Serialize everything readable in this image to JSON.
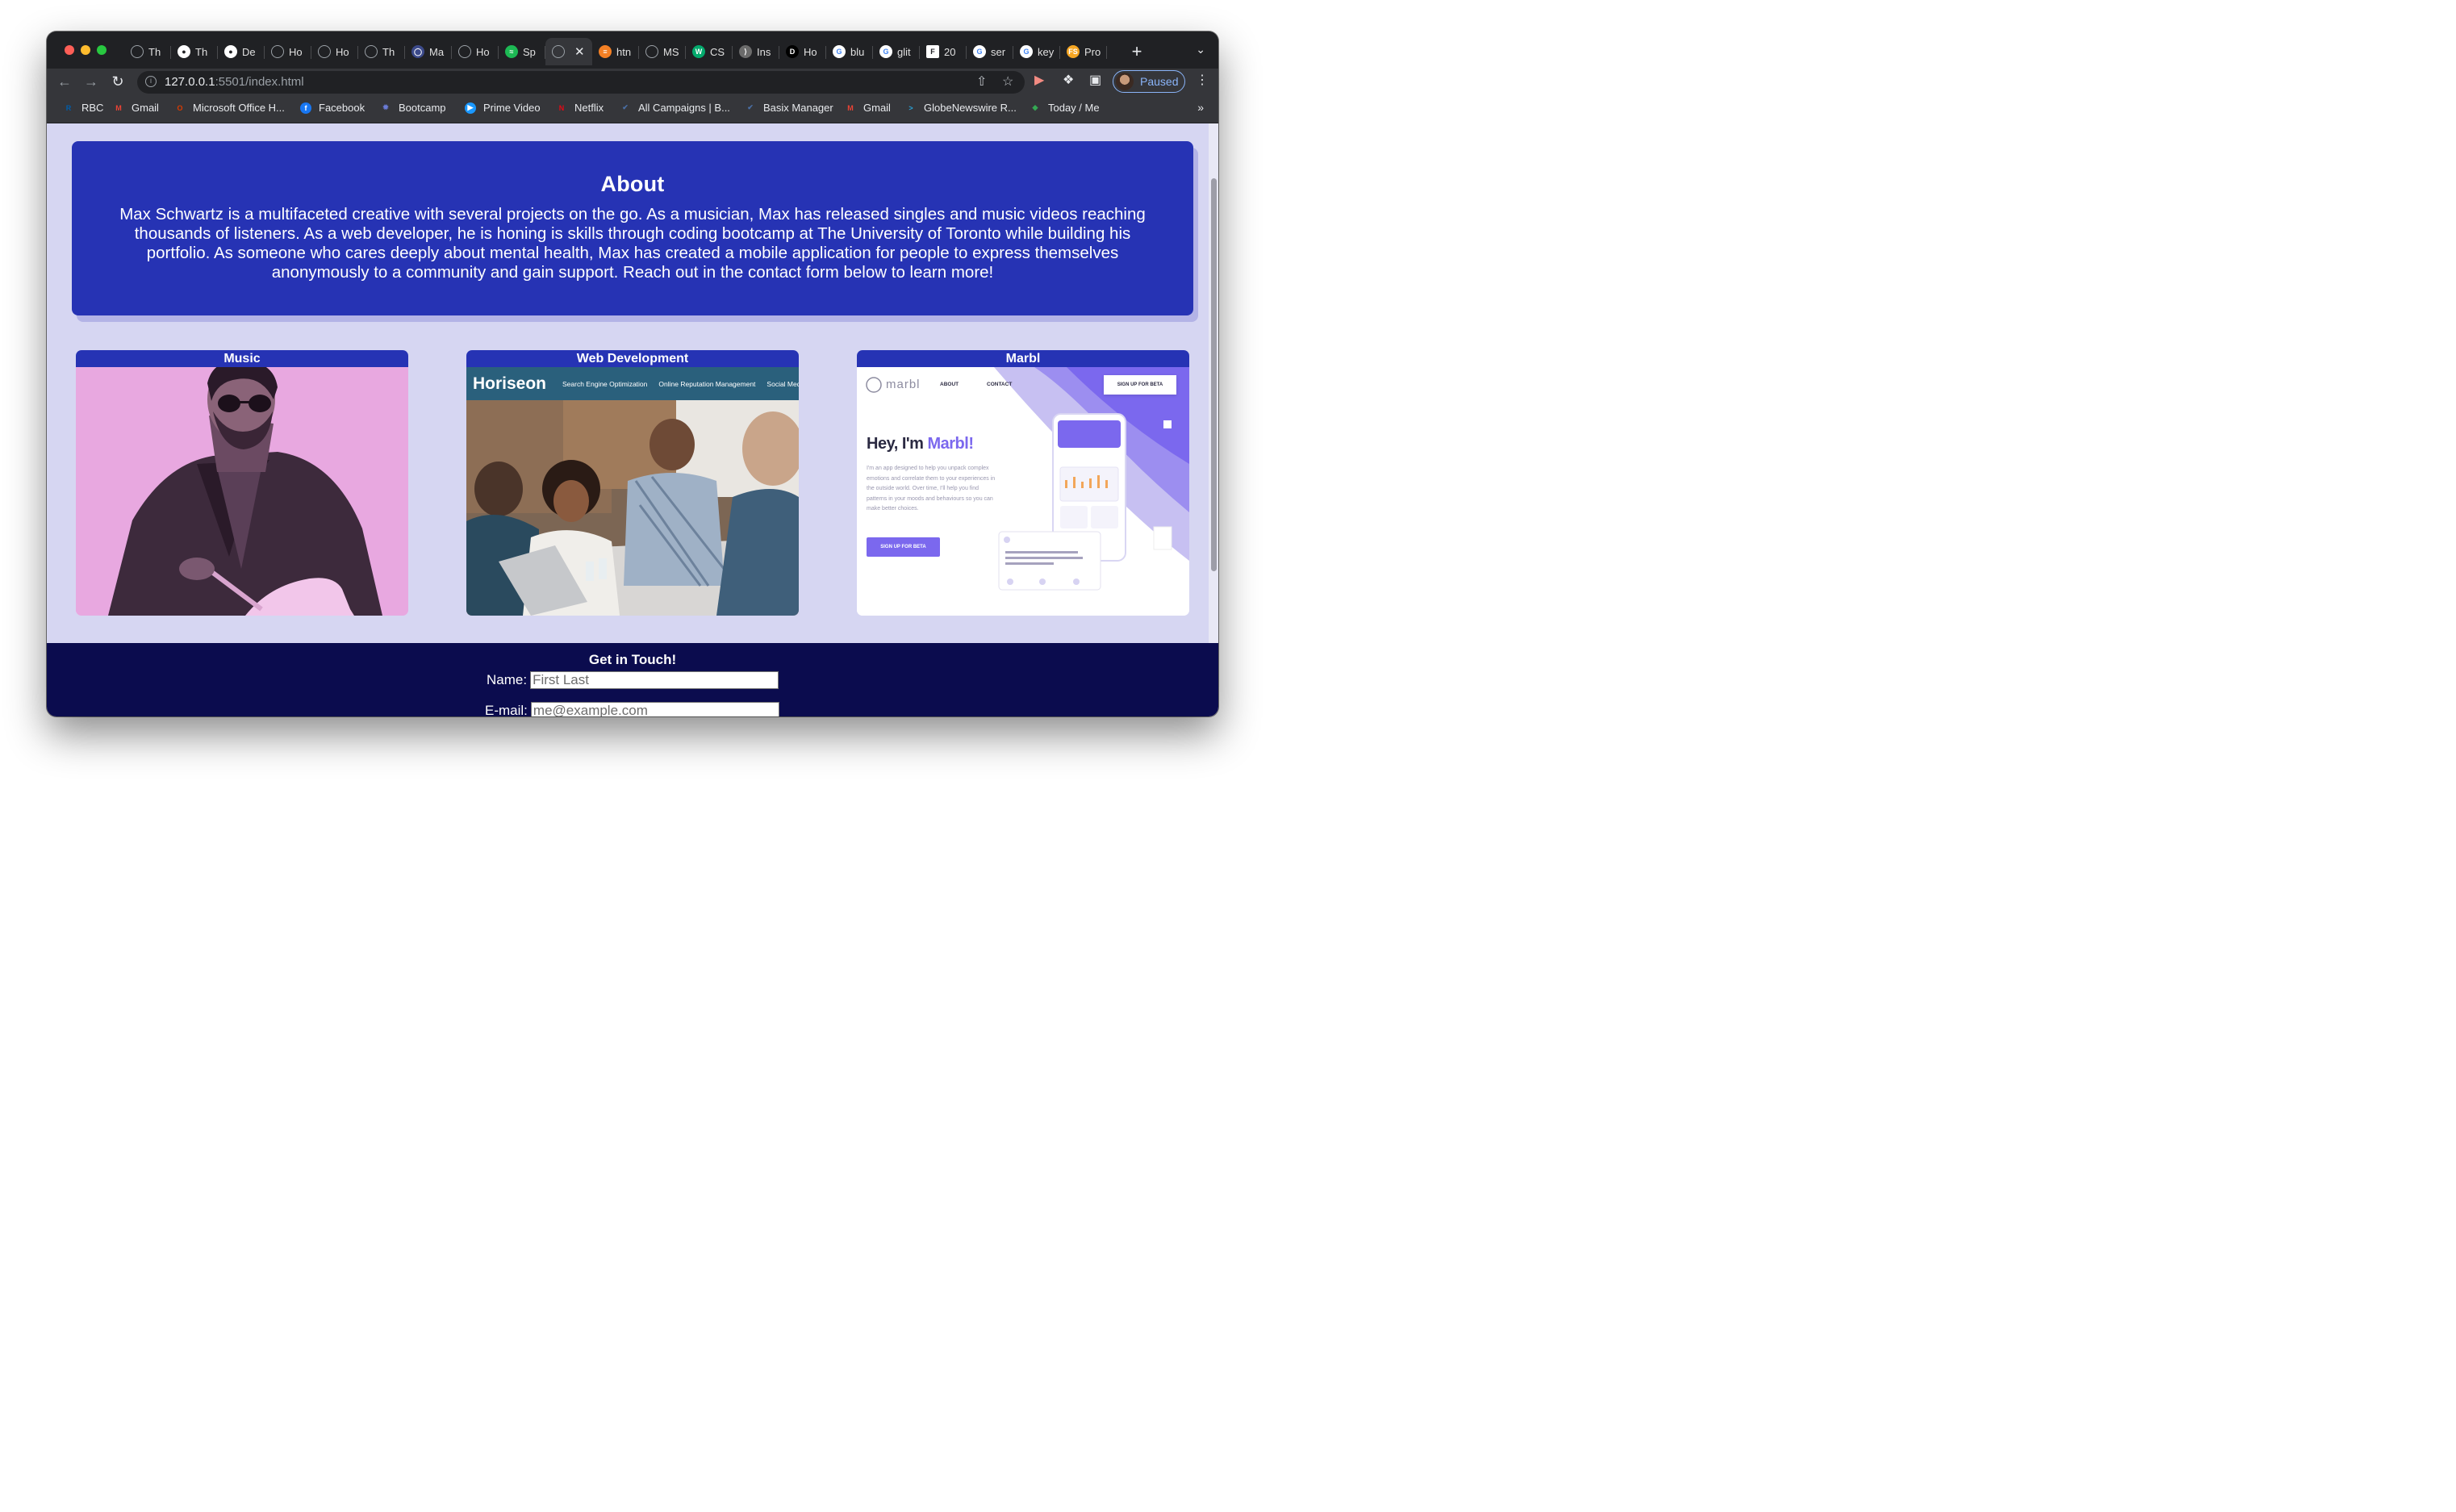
{
  "tabs": [
    {
      "label": "Th",
      "icon": "globe-icon",
      "color": "#9aa0a6"
    },
    {
      "label": "Th",
      "icon": "github-icon",
      "color": "#ffffff"
    },
    {
      "label": "De",
      "icon": "github-icon",
      "color": "#ffffff"
    },
    {
      "label": "Ho",
      "icon": "globe-icon",
      "color": "#9aa0a6"
    },
    {
      "label": "Ho",
      "icon": "globe-icon",
      "color": "#9aa0a6"
    },
    {
      "label": "Th",
      "icon": "globe-icon",
      "color": "#9aa0a6"
    },
    {
      "label": "Ma",
      "icon": "marbl-icon",
      "color": "#3c4a8a"
    },
    {
      "label": "Ho",
      "icon": "globe-icon",
      "color": "#9aa0a6"
    },
    {
      "label": "Sp",
      "icon": "spotify-icon",
      "color": "#1db954"
    },
    {
      "label": "",
      "icon": "globe-icon",
      "color": "#9aa0a6",
      "active": true
    },
    {
      "label": "htn",
      "icon": "stackoverflow-icon",
      "color": "#f48024"
    },
    {
      "label": "MS",
      "icon": "globe-icon",
      "color": "#9aa0a6"
    },
    {
      "label": "CS",
      "icon": "w3schools-icon",
      "color": "#04aa6d"
    },
    {
      "label": "Ins",
      "icon": "insomnia-icon",
      "color": "#6b6b6b"
    },
    {
      "label": "Ho",
      "icon": "dev-icon",
      "color": "#000000"
    },
    {
      "label": "blu",
      "icon": "google-icon",
      "color": "#4285f4"
    },
    {
      "label": "glit",
      "icon": "google-icon",
      "color": "#4285f4"
    },
    {
      "label": "20",
      "icon": "f-icon",
      "color": "#ffffff"
    },
    {
      "label": "ser",
      "icon": "google-icon",
      "color": "#4285f4"
    },
    {
      "label": "key",
      "icon": "google-icon",
      "color": "#4285f4"
    },
    {
      "label": "Pro",
      "icon": "fs-icon",
      "color": "#f5a623"
    }
  ],
  "toolbar": {
    "url_host": "127.0.0.1",
    "url_rest": ":5501/index.html",
    "profile_status": "Paused"
  },
  "bookmarks": [
    {
      "label": "RBC",
      "icon": "rbc-icon",
      "color": "#005daa"
    },
    {
      "label": "Gmail",
      "icon": "gmail-icon",
      "color": "#ea4335"
    },
    {
      "label": "Microsoft Office H...",
      "icon": "office-icon",
      "color": "#d83b01"
    },
    {
      "label": "Facebook",
      "icon": "facebook-icon",
      "color": "#1877f2"
    },
    {
      "label": "Bootcamp",
      "icon": "bootcamp-icon",
      "color": "#6a7bd6"
    },
    {
      "label": "Prime Video",
      "icon": "prime-video-icon",
      "color": "#1a98ff"
    },
    {
      "label": "Netflix",
      "icon": "netflix-icon",
      "color": "#e50914"
    },
    {
      "label": "All Campaigns | B...",
      "icon": "campaign-icon",
      "color": "#4a6fa5"
    },
    {
      "label": "Basix Manager",
      "icon": "basix-icon",
      "color": "#4a6fa5"
    },
    {
      "label": "Gmail",
      "icon": "gmail-icon",
      "color": "#ea4335"
    },
    {
      "label": "GlobeNewswire R...",
      "icon": "globenewswire-icon",
      "color": "#2aa3d8"
    },
    {
      "label": "Today / Me",
      "icon": "today-icon",
      "color": "#34a853"
    }
  ],
  "about": {
    "title": "About",
    "body": "Max Schwartz is a multifaceted creative with several projects on the go. As a musician, Max has released singles and music videos reaching thousands of listeners. As a web developer, he is honing is skills through coding bootcamp at The University of Toronto while building his portfolio. As someone who cares deeply about mental health, Max has created a mobile application for people to express themselves anonymously to a community and gain support. Reach out in the contact form below to learn more!"
  },
  "projects": [
    {
      "title": "Music"
    },
    {
      "title": "Web Development",
      "site_logo": "Horiseon",
      "site_nav": [
        "Search Engine Optimization",
        "Online Reputation Management",
        "Social Media"
      ]
    },
    {
      "title": "Marbl",
      "app_logo": "marbl",
      "nav": [
        "ABOUT",
        "CONTACT"
      ],
      "cta_top": "SIGN UP FOR BETA",
      "heading_a": "Hey, I'm ",
      "heading_b": "Marbl!",
      "blurb": "I'm an app designed to help you unpack complex emotions and correlate them to your experiences in the outside world. Over time, I'll help you find patterns in your moods and behaviours so you can make better choices.",
      "cta_bottom": "SIGN UP FOR BETA"
    }
  ],
  "contact": {
    "title": "Get in Touch!",
    "name_label": "Name:",
    "name_placeholder": "First Last",
    "email_label": "E-mail:",
    "email_placeholder": "me@example.com"
  }
}
